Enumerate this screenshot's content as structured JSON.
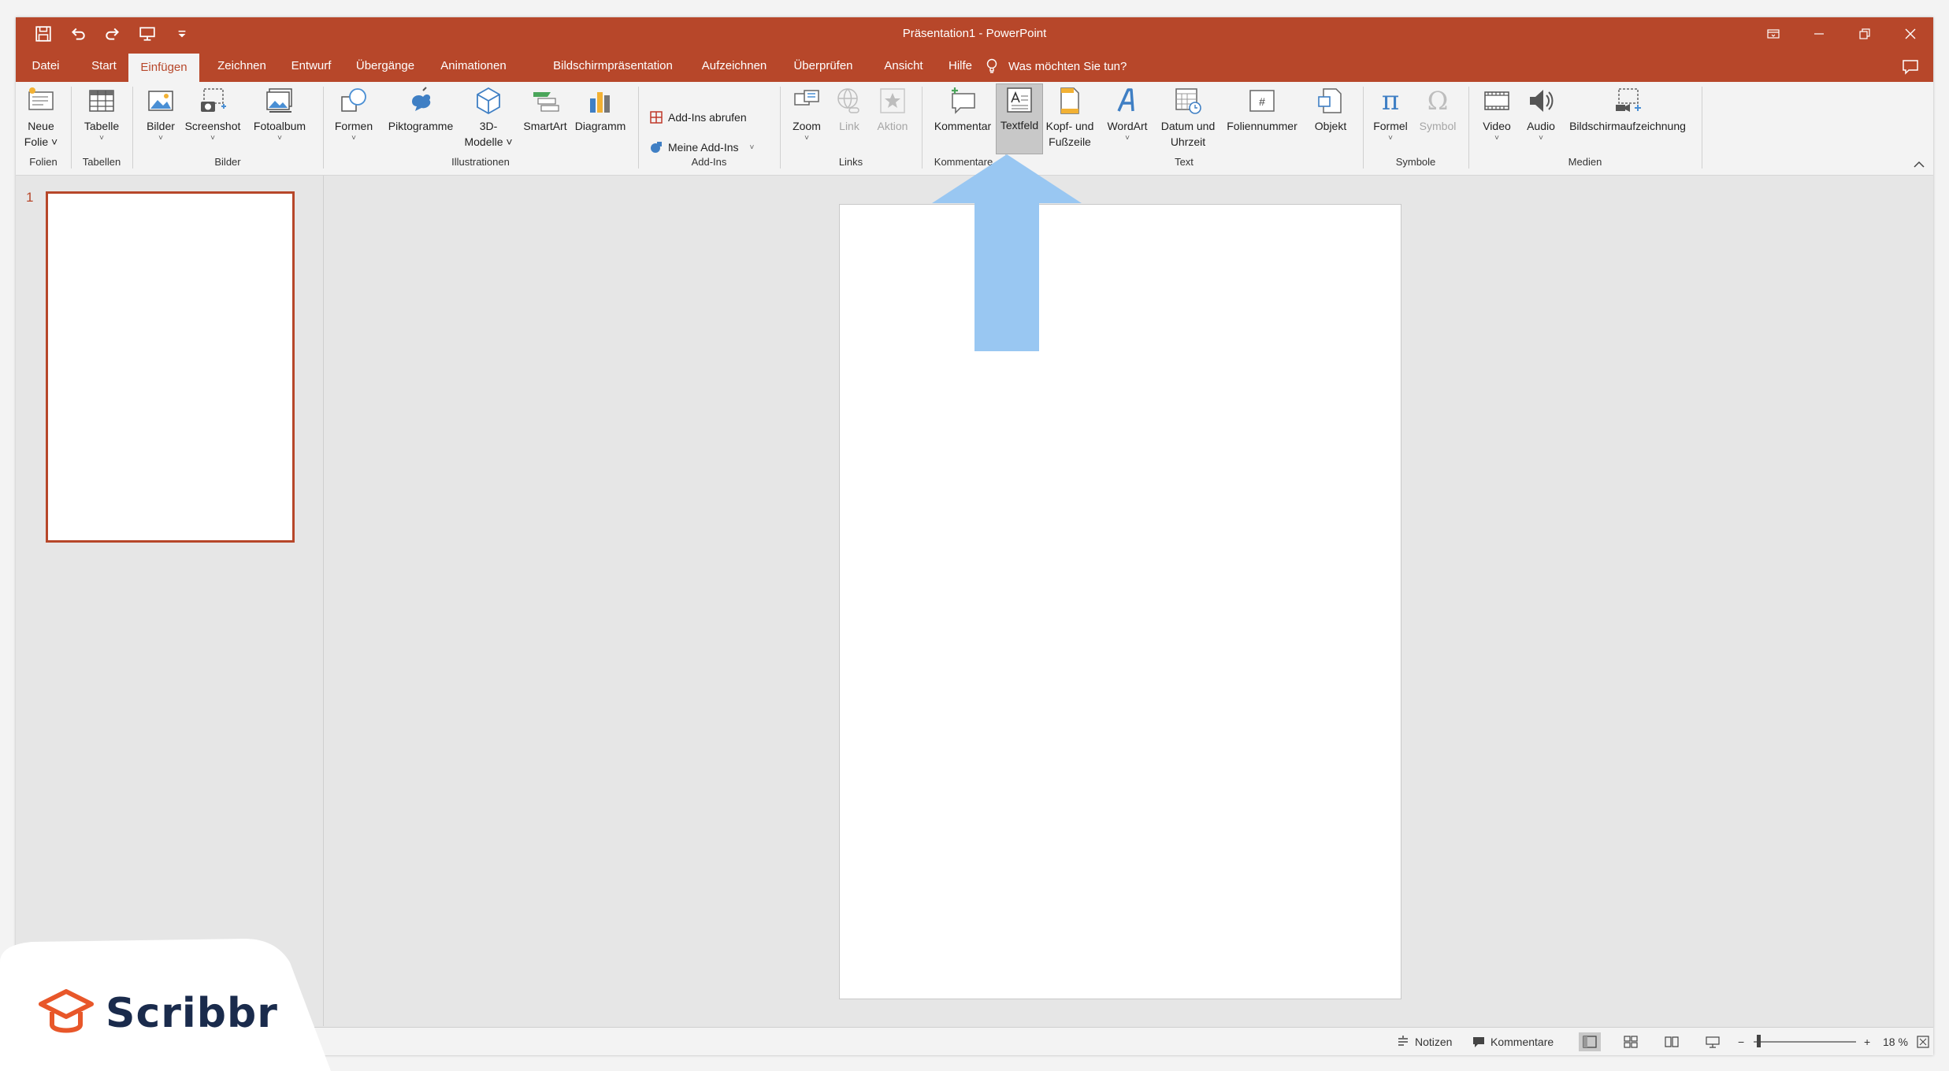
{
  "window": {
    "title": "Präsentation1  -  PowerPoint"
  },
  "tabs": [
    {
      "label": "Datei"
    },
    {
      "label": "Start"
    },
    {
      "label": "Einfügen"
    },
    {
      "label": "Zeichnen"
    },
    {
      "label": "Entwurf"
    },
    {
      "label": "Übergänge"
    },
    {
      "label": "Animationen"
    },
    {
      "label": "Bildschirmpräsentation"
    },
    {
      "label": "Aufzeichnen"
    },
    {
      "label": "Überprüfen"
    },
    {
      "label": "Ansicht"
    },
    {
      "label": "Hilfe"
    }
  ],
  "tellme": {
    "label": "Was möchten Sie tun?"
  },
  "ribbon": {
    "buttons": {
      "neue_folie": {
        "line1": "Neue",
        "line2": "Folie ˅"
      },
      "tabelle": {
        "line1": "Tabelle",
        "line2": "˅"
      },
      "bilder": {
        "line1": "Bilder",
        "line2": "˅"
      },
      "screenshot": {
        "line1": "Screenshot",
        "line2": "˅"
      },
      "fotoalbum": {
        "line1": "Fotoalbum",
        "line2": "˅"
      },
      "formen": {
        "line1": "Formen",
        "line2": "˅"
      },
      "piktogramme": {
        "line1": "Piktogramme"
      },
      "modelle": {
        "line1": "3D-",
        "line2": "Modelle ˅"
      },
      "smartart": {
        "line1": "SmartArt"
      },
      "diagramm": {
        "line1": "Diagramm"
      },
      "addins_abrufen": {
        "label": "Add-Ins abrufen"
      },
      "meine_addins": {
        "label": "Meine Add-Ins",
        "arrow": "˅"
      },
      "zoom": {
        "line1": "Zoom",
        "line2": "˅"
      },
      "link": {
        "line1": "Link"
      },
      "aktion": {
        "line1": "Aktion"
      },
      "kommentar": {
        "line1": "Kommentar"
      },
      "textfeld": {
        "line1": "Textfeld"
      },
      "kopf": {
        "line1": "Kopf- und",
        "line2": "Fußzeile"
      },
      "wordart": {
        "line1": "WordArt",
        "line2": "˅"
      },
      "datum": {
        "line1": "Datum und",
        "line2": "Uhrzeit"
      },
      "foliennummer": {
        "line1": "Foliennummer"
      },
      "objekt": {
        "line1": "Objekt"
      },
      "formel": {
        "line1": "Formel",
        "line2": "˅"
      },
      "symbol": {
        "line1": "Symbol"
      },
      "video": {
        "line1": "Video",
        "line2": "˅"
      },
      "audio": {
        "line1": "Audio",
        "line2": "˅"
      },
      "bildschirmaufzeichnung": {
        "line1": "Bildschirmaufzeichnung"
      }
    },
    "groups": {
      "folien": "Folien",
      "tabellen": "Tabellen",
      "bilder": "Bilder",
      "illustrationen": "Illustrationen",
      "addins": "Add-Ins",
      "links": "Links",
      "kommentare": "Kommentare",
      "text": "Text",
      "symbole": "Symbole",
      "medien": "Medien"
    }
  },
  "slides_panel": {
    "slide_number": "1"
  },
  "statusbar": {
    "notizen": "Notizen",
    "kommentare": "Kommentare",
    "zoom_minus": "−",
    "zoom_plus": "+",
    "zoom_level": "18 %"
  },
  "logo": {
    "text": "Scribbr"
  },
  "colors": {
    "accent": "#b7472a",
    "annotation_arrow": "#99c7f2",
    "logo_orange": "#e8572a",
    "logo_navy": "#1a2b4c"
  }
}
